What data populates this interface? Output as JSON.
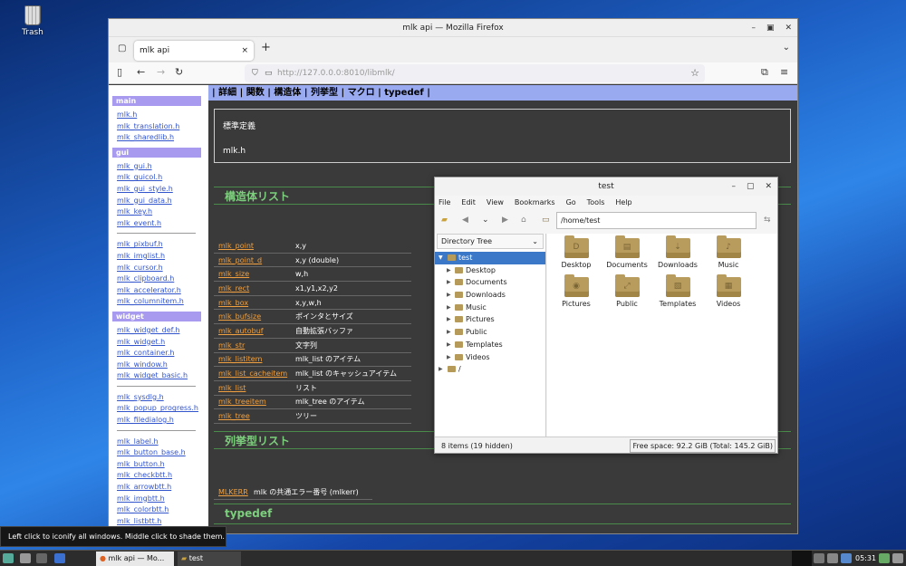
{
  "desktop": {
    "trash_label": "Trash"
  },
  "firefox": {
    "window_title": "mlk api — Mozilla Firefox",
    "tab_title": "mlk api",
    "tab_close": "×",
    "new_tab": "+",
    "url": "http://127.0.0.0:8010/libmlk/"
  },
  "sidebar": {
    "sections": [
      {
        "title": "main",
        "items": [
          "mlk.h",
          "mlk_translation.h",
          "mlk_sharedlib.h"
        ]
      },
      {
        "title": "gui",
        "items": [
          "mlk_gui.h",
          "mlk_guicol.h",
          "mlk_gui_style.h",
          "mlk_gui_data.h",
          "mlk_key.h",
          "mlk_event.h"
        ],
        "items2": [
          "mlk_pixbuf.h",
          "mlk_imglist.h",
          "mlk_cursor.h",
          "mlk_clipboard.h",
          "mlk_accelerator.h",
          "mlk_columnitem.h"
        ]
      },
      {
        "title": "widget",
        "items": [
          "mlk_widget_def.h",
          "mlk_widget.h",
          "mlk_container.h",
          "mlk_window.h",
          "mlk_widget_basic.h"
        ],
        "items2": [
          "mlk_sysdlg.h",
          "mlk_popup_progress.h",
          "mlk_filedialog.h"
        ],
        "items3": [
          "mlk_label.h",
          "mlk_button_base.h",
          "mlk_button.h",
          "mlk_checkbtt.h",
          "mlk_arrowbtt.h",
          "mlk_imgbtt.h",
          "mlk_colorbtt.h",
          "mlk_listbtt.h"
        ]
      }
    ]
  },
  "page": {
    "nav": "| 詳細 | 関数 | 構造体 | 列挙型 | マクロ | typedef |",
    "info_title": "標準定義",
    "info_file": "mlk.h",
    "struct_heading": "構造体リスト",
    "structs": [
      {
        "name": "mlk_point",
        "desc": "x,y"
      },
      {
        "name": "mlk_point_d",
        "desc": "x,y (double)"
      },
      {
        "name": "mlk_size",
        "desc": "w,h"
      },
      {
        "name": "mlk_rect",
        "desc": "x1,y1,x2,y2"
      },
      {
        "name": "mlk_box",
        "desc": "x,y,w,h"
      },
      {
        "name": "mlk_bufsize",
        "desc": "ポインタとサイズ"
      },
      {
        "name": "mlk_autobuf",
        "desc": "自動拡張バッファ"
      },
      {
        "name": "mlk_str",
        "desc": "文字列"
      },
      {
        "name": "mlk_listitem",
        "desc": "mlk_list のアイテム"
      },
      {
        "name": "mlk_list_cacheitem",
        "desc": "mlk_list のキャッシュアイテム"
      },
      {
        "name": "mlk_list",
        "desc": "リスト"
      },
      {
        "name": "mlk_treeitem",
        "desc": "mlk_tree のアイテム"
      },
      {
        "name": "mlk_tree",
        "desc": "ツリー"
      }
    ],
    "enum_heading": "列挙型リスト",
    "enum_name": "MLKERR",
    "enum_desc": "mlk の共通エラー番号 (mlkerr)",
    "typedef_heading": "typedef"
  },
  "filemanager": {
    "title": "test",
    "menu": [
      "File",
      "Edit",
      "View",
      "Bookmarks",
      "Go",
      "Tools",
      "Help"
    ],
    "location": "/home/test",
    "tree_header": "Directory Tree",
    "tree_root": "test",
    "tree_children": [
      "Desktop",
      "Documents",
      "Downloads",
      "Music",
      "Pictures",
      "Public",
      "Templates",
      "Videos"
    ],
    "tree_fs_root": "/",
    "icons": [
      {
        "label": "Desktop",
        "glyph": "D"
      },
      {
        "label": "Documents",
        "glyph": "▤"
      },
      {
        "label": "Downloads",
        "glyph": "⇣"
      },
      {
        "label": "Music",
        "glyph": "♪"
      },
      {
        "label": "Pictures",
        "glyph": "◉"
      },
      {
        "label": "Public",
        "glyph": "⤢"
      },
      {
        "label": "Templates",
        "glyph": "▧"
      },
      {
        "label": "Videos",
        "glyph": "▦"
      }
    ],
    "status_left": "8 items (19 hidden)",
    "status_right": "Free space: 92.2 GiB (Total: 145.2 GiB)"
  },
  "tooltip": "Left click to iconify all windows.  Middle click to shade them.",
  "taskbar": {
    "firefox_label": "mlk api — Mo...",
    "fm_label": "test",
    "clock": "05:31"
  }
}
